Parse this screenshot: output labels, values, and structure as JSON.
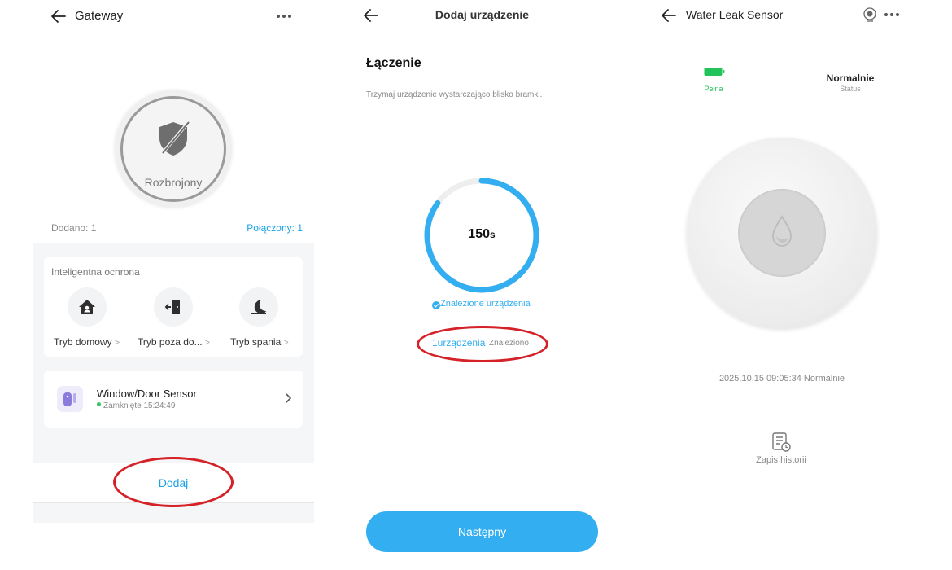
{
  "panel1": {
    "title": "Gateway",
    "arm_status": "Rozbrojony",
    "added": "Dodano: 1",
    "connected": "Połączony: 1",
    "smart_protection": {
      "title": "Inteligentna ochrona",
      "modes": [
        {
          "label": "Tryb domowy",
          "icon": "home-shield-icon"
        },
        {
          "label": "Tryb poza do...",
          "icon": "away-exit-icon"
        },
        {
          "label": "Tryb spania",
          "icon": "sleep-moon-icon"
        }
      ]
    },
    "device": {
      "name": "Window/Door Sensor",
      "status": "Zamknięte 15:24:49",
      "status_color": "#3cc65e"
    },
    "add_label": "Dodaj",
    "accent": "#1aa2e6"
  },
  "panel2": {
    "title": "Dodaj urządzenie",
    "section_title": "Łączenie",
    "hint": "Trzymaj urządzenie wystarczająco blisko bramki.",
    "countdown": "150",
    "countdown_unit": "s",
    "progress": 0.85,
    "found_status": "Znalezione urządzenia",
    "found_count": "1urządzenia",
    "found_word": "Znaleziono",
    "next_label": "Następny",
    "accent": "#33aef0"
  },
  "panel3": {
    "title": "Water Leak Sensor",
    "battery_label": "Pełna",
    "status_value": "Normalnie",
    "status_label": "Status",
    "last_event": "2025.10.15  09:05:34  Normalnie",
    "history_label": "Zapis historii",
    "battery_color": "#22c35a"
  }
}
